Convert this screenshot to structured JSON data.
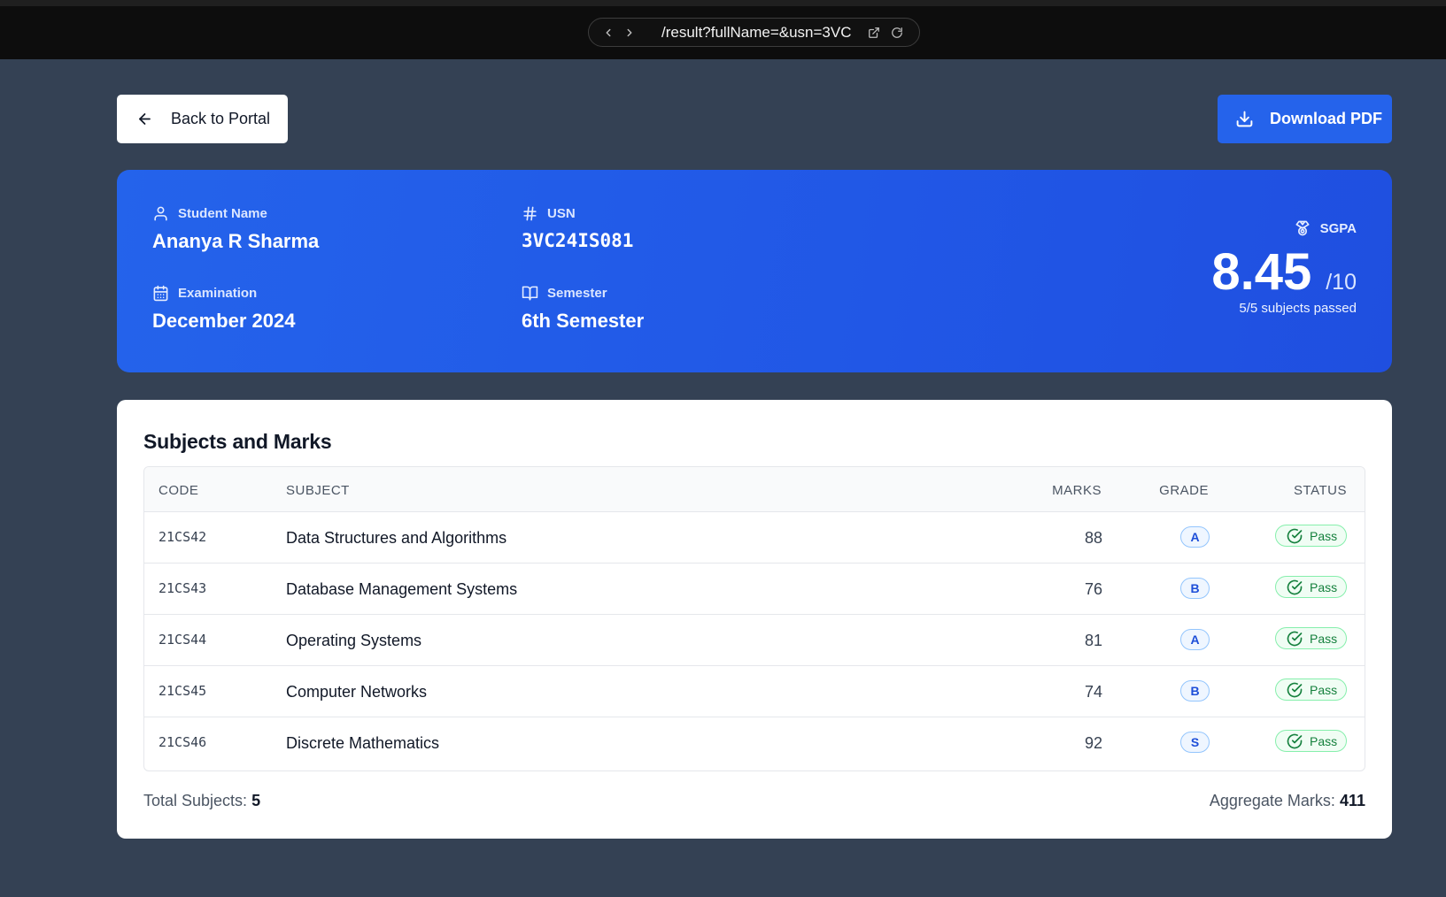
{
  "browser": {
    "url": "/result?fullName=&usn=3VC"
  },
  "actions": {
    "back_label": "Back to Portal",
    "download_label": "Download PDF"
  },
  "student": {
    "name_label": "Student Name",
    "name": "Ananya R Sharma",
    "usn_label": "USN",
    "usn": "3VC24IS081",
    "exam_label": "Examination",
    "exam": "December 2024",
    "semester_label": "Semester",
    "semester": "6th Semester"
  },
  "sgpa": {
    "label": "SGPA",
    "value": "8.45",
    "out_of": "/10",
    "passed_text": "5/5 subjects passed"
  },
  "marks_card": {
    "title": "Subjects and Marks",
    "columns": [
      "CODE",
      "SUBJECT",
      "MARKS",
      "GRADE",
      "STATUS"
    ],
    "rows": [
      {
        "code": "21CS42",
        "subject": "Data Structures and Algorithms",
        "marks": "88",
        "grade": "A",
        "status": "Pass"
      },
      {
        "code": "21CS43",
        "subject": "Database Management Systems",
        "marks": "76",
        "grade": "B",
        "status": "Pass"
      },
      {
        "code": "21CS44",
        "subject": "Operating Systems",
        "marks": "81",
        "grade": "A",
        "status": "Pass"
      },
      {
        "code": "21CS45",
        "subject": "Computer Networks",
        "marks": "74",
        "grade": "B",
        "status": "Pass"
      },
      {
        "code": "21CS46",
        "subject": "Discrete Mathematics",
        "marks": "92",
        "grade": "S",
        "status": "Pass"
      }
    ],
    "total_label": "Total Subjects:",
    "total_value": "5",
    "aggregate_label": "Aggregate Marks:",
    "aggregate_value": "411"
  },
  "colors": {
    "page_background": "#344154",
    "accent": "#2563eb",
    "pass_green": "#15803d",
    "grade_blue": "#1d4ed8"
  },
  "icons": {
    "back": "arrow-left-icon",
    "download": "download-icon",
    "name": "user-icon",
    "usn": "hash-icon",
    "exam": "calendar-icon",
    "semester": "book-open-icon",
    "sgpa": "award-icon",
    "status": "check-circle-icon"
  }
}
